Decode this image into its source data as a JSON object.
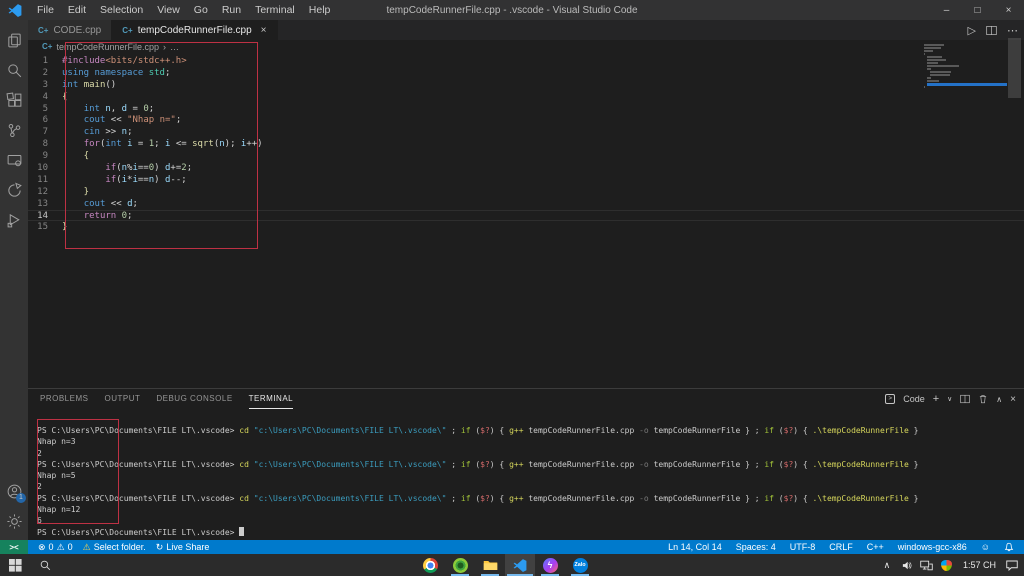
{
  "colors": {
    "kw": "#569CD6",
    "ctrl": "#C586C0",
    "var": "#9CDCFE",
    "fn": "#DCDCAA",
    "num": "#B5CEA8",
    "str": "#CE9178",
    "pun": "#D4D4D4",
    "type": "#4EC9B0",
    "inc": "#C586C0",
    "hdr": "#CE9178",
    "status": "#007ACC",
    "remote": "#16825D",
    "anno": "#BE3144"
  },
  "window": {
    "title": "tempCodeRunnerFile.cpp - .vscode - Visual Studio Code",
    "minimize": "–",
    "maximize": "□",
    "close": "×"
  },
  "menu": [
    "File",
    "Edit",
    "Selection",
    "View",
    "Go",
    "Run",
    "Terminal",
    "Help"
  ],
  "icons": {
    "cpp": "C+",
    "tab_close": "×",
    "run": "▷",
    "more": "⋯",
    "plus": "+",
    "chevron_down": "∨",
    "chevron_up": "∧",
    "panel_close": "×",
    "error": "⊗",
    "warning": "⚠",
    "live_share": "↻",
    "remote": "><",
    "shell_prompt": ">",
    "feedback": "☺",
    "tray_chevron": "∧",
    "messenger_bolt": "ϟ",
    "zalo": "Zalo"
  },
  "tabs": [
    {
      "label": "CODE.cpp",
      "active": false
    },
    {
      "label": "tempCodeRunnerFile.cpp",
      "active": true
    }
  ],
  "breadcrumb": {
    "file": "tempCodeRunnerFile.cpp",
    "sep": "›",
    "ellipsis": "…"
  },
  "editor": {
    "current_line": 14,
    "lines": [
      [
        [
          "inc",
          "#include"
        ],
        [
          "hdr",
          "<bits/stdc++.h>"
        ]
      ],
      [
        [
          "kw",
          "using"
        ],
        [
          "pun",
          " "
        ],
        [
          "kw",
          "namespace"
        ],
        [
          "pun",
          " "
        ],
        [
          "type",
          "std"
        ],
        [
          "pun",
          ";"
        ]
      ],
      [
        [
          "kw",
          "int"
        ],
        [
          "pun",
          " "
        ],
        [
          "fn",
          "main"
        ],
        [
          "pun",
          "()"
        ]
      ],
      [
        [
          "fn",
          "{"
        ]
      ],
      [
        [
          "pun",
          "    "
        ],
        [
          "kw",
          "int"
        ],
        [
          "pun",
          " "
        ],
        [
          "var",
          "n"
        ],
        [
          "pun",
          ", "
        ],
        [
          "var",
          "d"
        ],
        [
          "pun",
          " = "
        ],
        [
          "num",
          "0"
        ],
        [
          "pun",
          ";"
        ]
      ],
      [
        [
          "pun",
          "    "
        ],
        [
          "kw",
          "cout"
        ],
        [
          "pun",
          " << "
        ],
        [
          "str",
          "\"Nhap n=\""
        ],
        [
          "pun",
          ";"
        ]
      ],
      [
        [
          "pun",
          "    "
        ],
        [
          "kw",
          "cin"
        ],
        [
          "pun",
          " >> "
        ],
        [
          "var",
          "n"
        ],
        [
          "pun",
          ";"
        ]
      ],
      [
        [
          "pun",
          "    "
        ],
        [
          "ctrl",
          "for"
        ],
        [
          "pun",
          "("
        ],
        [
          "kw",
          "int"
        ],
        [
          "pun",
          " "
        ],
        [
          "var",
          "i"
        ],
        [
          "pun",
          " = "
        ],
        [
          "num",
          "1"
        ],
        [
          "pun",
          "; "
        ],
        [
          "var",
          "i"
        ],
        [
          "pun",
          " <= "
        ],
        [
          "fn",
          "sqrt"
        ],
        [
          "pun",
          "("
        ],
        [
          "var",
          "n"
        ],
        [
          "pun",
          "); "
        ],
        [
          "var",
          "i"
        ],
        [
          "pun",
          "++)"
        ]
      ],
      [
        [
          "fn",
          "    {"
        ]
      ],
      [
        [
          "pun",
          "        "
        ],
        [
          "ctrl",
          "if"
        ],
        [
          "pun",
          "("
        ],
        [
          "var",
          "n"
        ],
        [
          "pun",
          "%"
        ],
        [
          "var",
          "i"
        ],
        [
          "pun",
          "=="
        ],
        [
          "num",
          "0"
        ],
        [
          "pun",
          ") "
        ],
        [
          "var",
          "d"
        ],
        [
          "pun",
          "+="
        ],
        [
          "num",
          "2"
        ],
        [
          "pun",
          ";"
        ]
      ],
      [
        [
          "pun",
          "        "
        ],
        [
          "ctrl",
          "if"
        ],
        [
          "pun",
          "("
        ],
        [
          "var",
          "i"
        ],
        [
          "pun",
          "*"
        ],
        [
          "var",
          "i"
        ],
        [
          "pun",
          "=="
        ],
        [
          "var",
          "n"
        ],
        [
          "pun",
          ") "
        ],
        [
          "var",
          "d"
        ],
        [
          "pun",
          "--;"
        ]
      ],
      [
        [
          "fn",
          "    }"
        ]
      ],
      [
        [
          "pun",
          "    "
        ],
        [
          "kw",
          "cout"
        ],
        [
          "pun",
          " << "
        ],
        [
          "var",
          "d"
        ],
        [
          "pun",
          ";"
        ]
      ],
      [
        [
          "pun",
          "    "
        ],
        [
          "ctrl",
          "return"
        ],
        [
          "pun",
          " "
        ],
        [
          "num",
          "0"
        ],
        [
          "pun",
          ";"
        ]
      ],
      [
        [
          "fn",
          "}"
        ]
      ]
    ]
  },
  "panel": {
    "tabs": [
      "PROBLEMS",
      "OUTPUT",
      "DEBUG CONSOLE",
      "TERMINAL"
    ],
    "active_tab": "TERMINAL",
    "shell_label": "Code",
    "terminal_lines": [
      [
        [
          "def",
          "PS C:\\Users\\PC\\Documents\\FILE LT\\.vscode> "
        ],
        [
          "cmd",
          "cd"
        ],
        [
          "def",
          " "
        ],
        [
          "str",
          "\"c:\\Users\\PC\\Documents\\FILE LT\\.vscode\\\""
        ],
        [
          "def",
          " ; "
        ],
        [
          "kw",
          "if"
        ],
        [
          "def",
          " ("
        ],
        [
          "var",
          "$?"
        ],
        [
          "def",
          ") { "
        ],
        [
          "cmd",
          "g++"
        ],
        [
          "def",
          " tempCodeRunnerFile.cpp "
        ],
        [
          "dim",
          "-o"
        ],
        [
          "def",
          " tempCodeRunnerFile } ; "
        ],
        [
          "kw",
          "if"
        ],
        [
          "def",
          " ("
        ],
        [
          "var",
          "$?"
        ],
        [
          "def",
          ") { "
        ],
        [
          "cmd",
          ".\\tempCodeRunnerFile"
        ],
        [
          "def",
          " }"
        ]
      ],
      [
        [
          "def",
          "Nhap n=3"
        ]
      ],
      [
        [
          "def",
          "2"
        ]
      ],
      [
        [
          "def",
          "PS C:\\Users\\PC\\Documents\\FILE LT\\.vscode> "
        ],
        [
          "cmd",
          "cd"
        ],
        [
          "def",
          " "
        ],
        [
          "str",
          "\"c:\\Users\\PC\\Documents\\FILE LT\\.vscode\\\""
        ],
        [
          "def",
          " ; "
        ],
        [
          "kw",
          "if"
        ],
        [
          "def",
          " ("
        ],
        [
          "var",
          "$?"
        ],
        [
          "def",
          ") { "
        ],
        [
          "cmd",
          "g++"
        ],
        [
          "def",
          " tempCodeRunnerFile.cpp "
        ],
        [
          "dim",
          "-o"
        ],
        [
          "def",
          " tempCodeRunnerFile } ; "
        ],
        [
          "kw",
          "if"
        ],
        [
          "def",
          " ("
        ],
        [
          "var",
          "$?"
        ],
        [
          "def",
          ") { "
        ],
        [
          "cmd",
          ".\\tempCodeRunnerFile"
        ],
        [
          "def",
          " }"
        ]
      ],
      [
        [
          "def",
          "Nhap n=5"
        ]
      ],
      [
        [
          "def",
          "2"
        ]
      ],
      [
        [
          "def",
          "PS C:\\Users\\PC\\Documents\\FILE LT\\.vscode> "
        ],
        [
          "cmd",
          "cd"
        ],
        [
          "def",
          " "
        ],
        [
          "str",
          "\"c:\\Users\\PC\\Documents\\FILE LT\\.vscode\\\""
        ],
        [
          "def",
          " ; "
        ],
        [
          "kw",
          "if"
        ],
        [
          "def",
          " ("
        ],
        [
          "var",
          "$?"
        ],
        [
          "def",
          ") { "
        ],
        [
          "cmd",
          "g++"
        ],
        [
          "def",
          " tempCodeRunnerFile.cpp "
        ],
        [
          "dim",
          "-o"
        ],
        [
          "def",
          " tempCodeRunnerFile } ; "
        ],
        [
          "kw",
          "if"
        ],
        [
          "def",
          " ("
        ],
        [
          "var",
          "$?"
        ],
        [
          "def",
          ") { "
        ],
        [
          "cmd",
          ".\\tempCodeRunnerFile"
        ],
        [
          "def",
          " }"
        ]
      ],
      [
        [
          "def",
          "Nhap n=12"
        ]
      ],
      [
        [
          "def",
          "6"
        ]
      ],
      [
        [
          "def",
          "PS C:\\Users\\PC\\Documents\\FILE LT\\.vscode> "
        ],
        [
          "cursor",
          ""
        ]
      ]
    ]
  },
  "status_bar": {
    "errors": "0",
    "warnings": "0",
    "select_folder": "Select folder.",
    "live_share": "Live Share",
    "line_col": "Ln 14, Col 14",
    "spaces": "Spaces: 4",
    "encoding": "UTF-8",
    "eol": "CRLF",
    "language": "C++",
    "compiler": "windows-gcc-x86"
  },
  "taskbar": {
    "clock": "1:57 CH"
  }
}
